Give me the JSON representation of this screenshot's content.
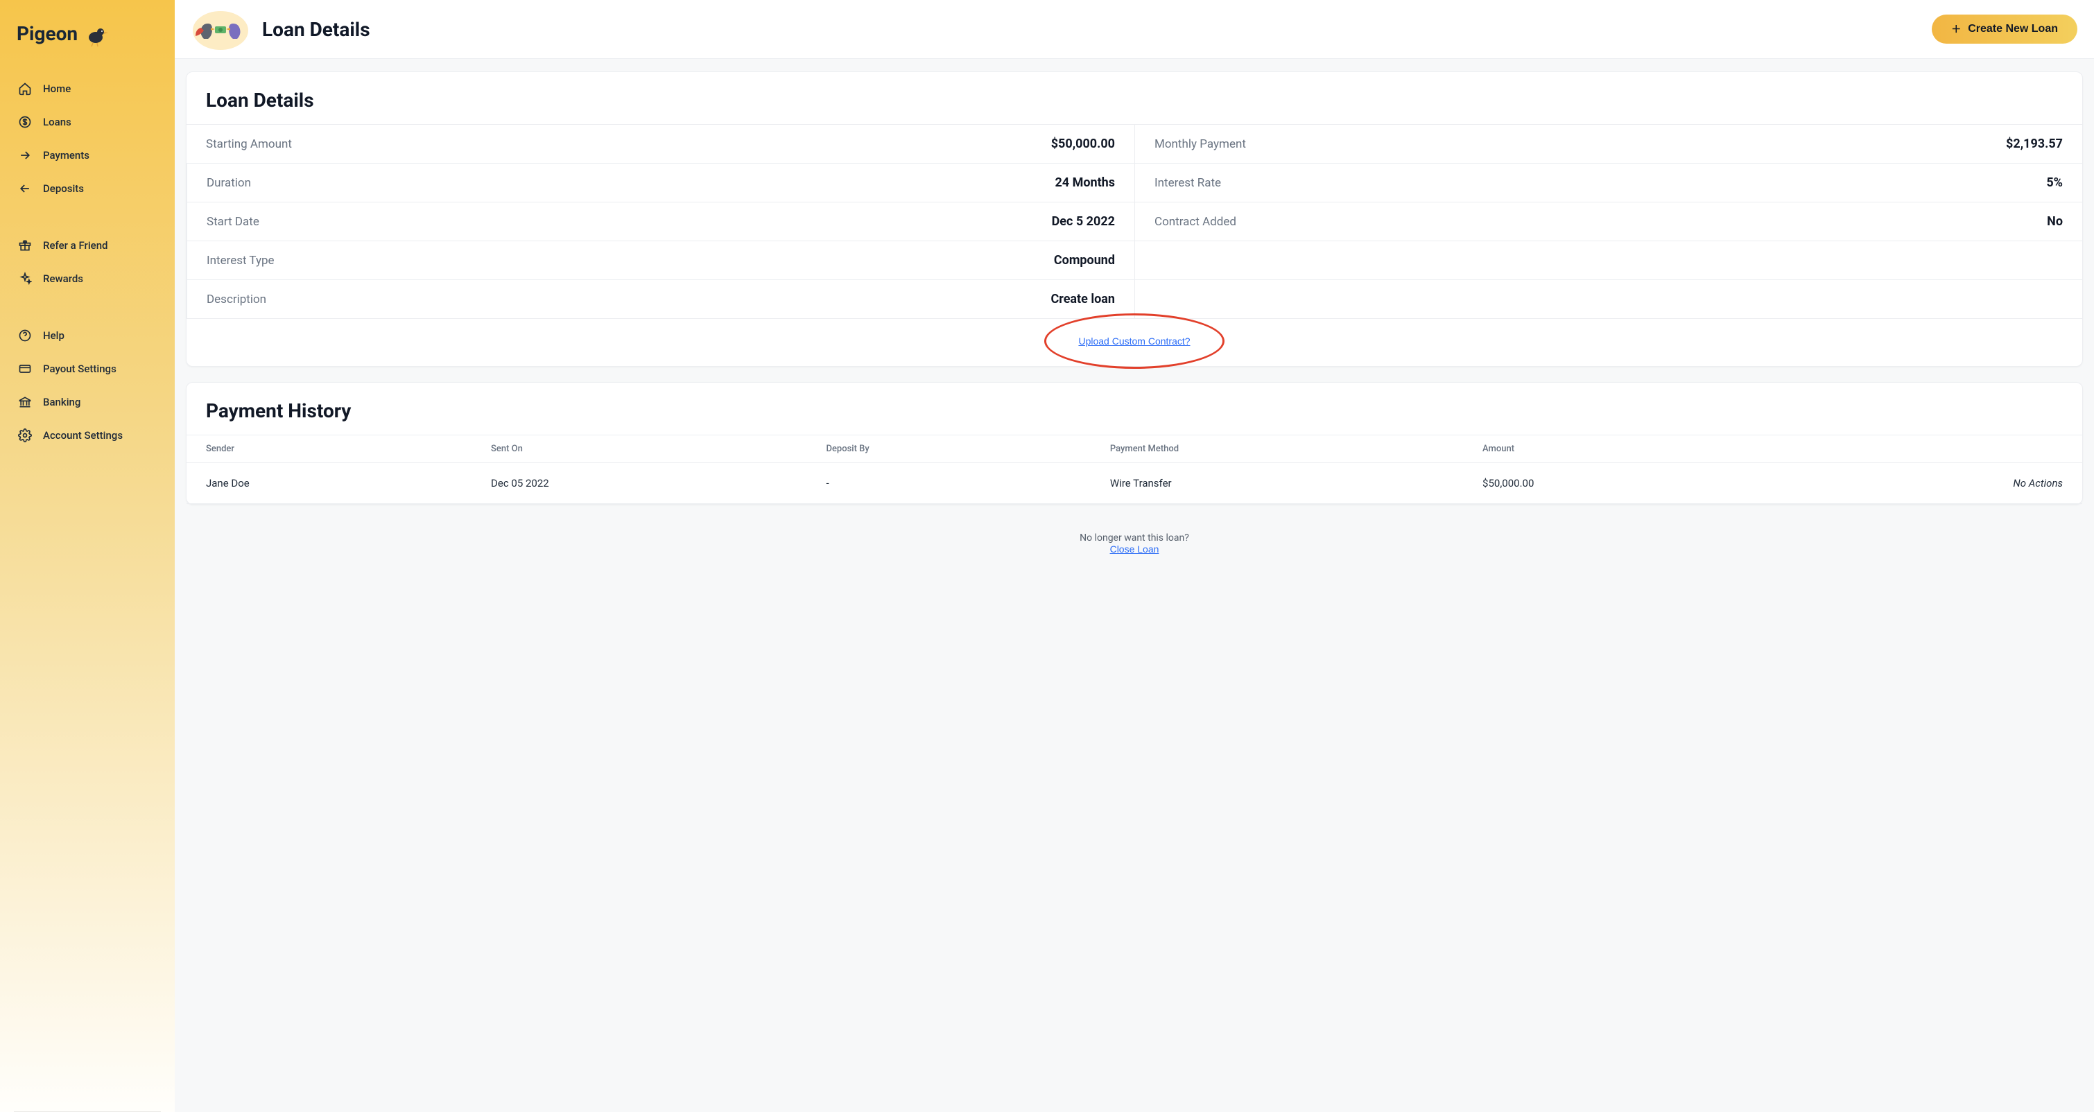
{
  "brand": {
    "name": "Pigeon"
  },
  "sidebar": {
    "group1": [
      {
        "label": "Home",
        "icon": "home"
      },
      {
        "label": "Loans",
        "icon": "dollar-circle"
      },
      {
        "label": "Payments",
        "icon": "arrow-right"
      },
      {
        "label": "Deposits",
        "icon": "arrow-left"
      }
    ],
    "group2": [
      {
        "label": "Refer a Friend",
        "icon": "gift"
      },
      {
        "label": "Rewards",
        "icon": "sparkle"
      }
    ],
    "group3": [
      {
        "label": "Help",
        "icon": "help-circle"
      },
      {
        "label": "Payout Settings",
        "icon": "card"
      },
      {
        "label": "Banking",
        "icon": "bank"
      },
      {
        "label": "Account Settings",
        "icon": "gear"
      }
    ]
  },
  "header": {
    "title": "Loan Details",
    "create_button": "Create New Loan"
  },
  "loan_details_card": {
    "title": "Loan Details",
    "rows": [
      {
        "left_label": "Starting Amount",
        "left_value": "$50,000.00",
        "right_label": "Monthly Payment",
        "right_value": "$2,193.57"
      },
      {
        "left_label": "Duration",
        "left_value": "24 Months",
        "right_label": "Interest Rate",
        "right_value": "5%"
      },
      {
        "left_label": "Start Date",
        "left_value": "Dec 5 2022",
        "right_label": "Contract Added",
        "right_value": "No"
      },
      {
        "left_label": "Interest Type",
        "left_value": "Compound",
        "right_label": "",
        "right_value": ""
      },
      {
        "left_label": "Description",
        "left_value": "Create loan",
        "right_label": "",
        "right_value": ""
      }
    ],
    "upload_link": "Upload Custom Contract?"
  },
  "payment_history_card": {
    "title": "Payment History",
    "columns": [
      "Sender",
      "Sent On",
      "Deposit By",
      "Payment Method",
      "Amount",
      ""
    ],
    "rows": [
      {
        "sender": "Jane Doe",
        "sent_on": "Dec 05 2022",
        "deposit_by": "-",
        "method": "Wire Transfer",
        "amount": "$50,000.00",
        "actions": "No Actions"
      }
    ]
  },
  "close_loan": {
    "prompt": "No longer want this loan?",
    "link": "Close Loan"
  }
}
